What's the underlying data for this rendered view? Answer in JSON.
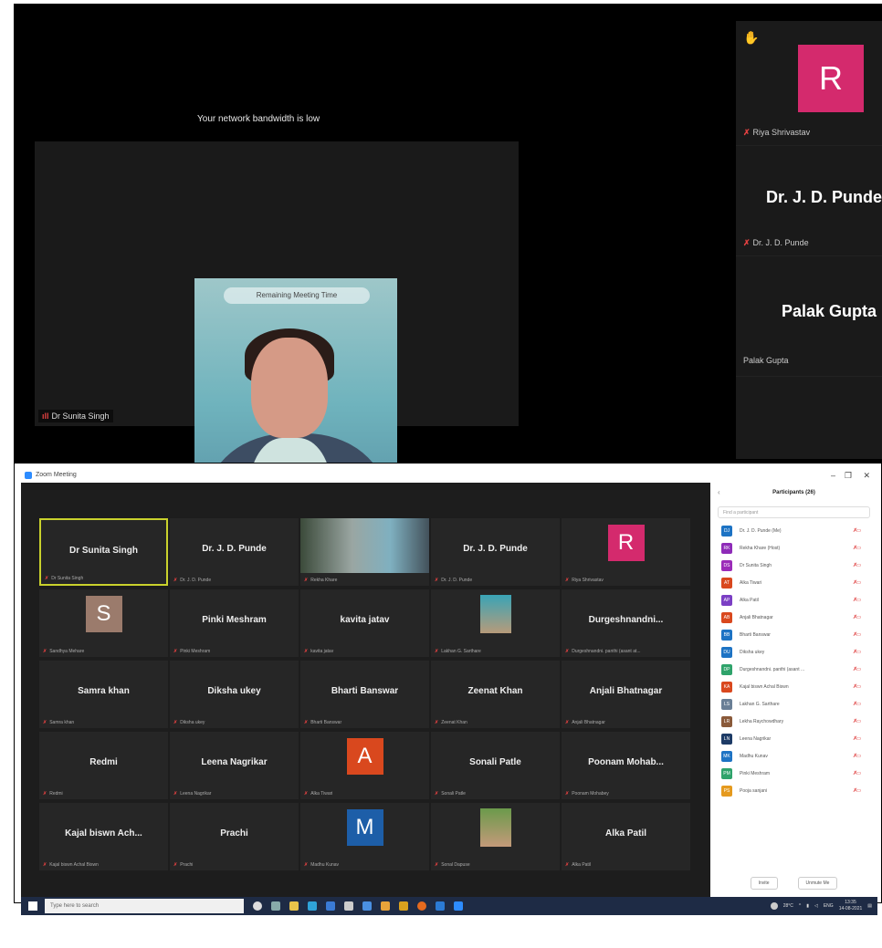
{
  "top_panel": {
    "bandwidth_warning": "Your network bandwidth is low",
    "video_banner": "Remaining Meeting Time",
    "main_speaker_name": "Dr Sunita Singh",
    "side_tiles": [
      {
        "avatar_letter": "R",
        "label": "Riya Shrivastav",
        "big_name": "",
        "avatar_color": "#d42a6d"
      },
      {
        "avatar_letter": "",
        "label": "Dr. J. D. Punde",
        "big_name": "Dr. J. D. Punde"
      },
      {
        "avatar_letter": "",
        "label": "Palak Gupta",
        "big_name": "Palak Gupta"
      }
    ]
  },
  "zoom_window": {
    "title": "Zoom Meeting",
    "gallery": [
      {
        "name": "Dr Sunita Singh",
        "label": "Dr Sunita Singh",
        "kind": "name",
        "active": true
      },
      {
        "name": "Dr. J. D. Punde",
        "label": "Dr. J. D. Punde",
        "kind": "name"
      },
      {
        "name": "",
        "label": "Rekha Khare",
        "kind": "video"
      },
      {
        "name": "Dr. J. D. Punde",
        "label": "Dr. J. D. Punde",
        "kind": "name"
      },
      {
        "name": "",
        "label": "Riya Shrivastav",
        "kind": "avatar",
        "letter": "R",
        "color": "#d42a6d"
      },
      {
        "name": "",
        "label": "Sandhya Mehare",
        "kind": "avatar",
        "letter": "S",
        "color": "#9b7b6c"
      },
      {
        "name": "Pinki Meshram",
        "label": "Pinki Meshram",
        "kind": "name"
      },
      {
        "name": "kavita jatav",
        "label": "kavita jatav",
        "kind": "name"
      },
      {
        "name": "",
        "label": "Lakhan G. Sarthare",
        "kind": "photo"
      },
      {
        "name": "Durgeshnandni...",
        "label": "Durgeshnandni. panthi (asant at...",
        "kind": "name"
      },
      {
        "name": "Samra khan",
        "label": "Samra khan",
        "kind": "name"
      },
      {
        "name": "Diksha ukey",
        "label": "Diksha ukey",
        "kind": "name"
      },
      {
        "name": "Bharti Banswar",
        "label": "Bharti Banswar",
        "kind": "name"
      },
      {
        "name": "Zeenat Khan",
        "label": "Zeenat Khan",
        "kind": "name"
      },
      {
        "name": "Anjali Bhatnagar",
        "label": "Anjali Bhatnagar",
        "kind": "name"
      },
      {
        "name": "Redmi",
        "label": "Redmi",
        "kind": "name"
      },
      {
        "name": "Leena Nagrikar",
        "label": "Leena Nagrikar",
        "kind": "name"
      },
      {
        "name": "",
        "label": "Alka Tiwari",
        "kind": "avatar",
        "letter": "A",
        "color": "#d9481e"
      },
      {
        "name": "Sonali Patle",
        "label": "Sonali Patle",
        "kind": "name"
      },
      {
        "name": "Poonam Mohab...",
        "label": "Poonam Mohabey",
        "kind": "name"
      },
      {
        "name": "Kajal biswn Ach...",
        "label": "Kajal biswn Achal Biswn",
        "kind": "name"
      },
      {
        "name": "Prachi",
        "label": "Prachi",
        "kind": "name"
      },
      {
        "name": "",
        "label": "Madhu Kunav",
        "kind": "avatar",
        "letter": "M",
        "color": "#1d5ea8"
      },
      {
        "name": "",
        "label": "Sonal Dapuse",
        "kind": "photo2"
      },
      {
        "name": "Alka Patil",
        "label": "Alka Patil",
        "kind": "name"
      }
    ],
    "participants": {
      "title": "Participants (26)",
      "search_placeholder": "Find a participant",
      "items": [
        {
          "initials": "DJ",
          "name": "Dr. J. D. Punde (Me)",
          "color": "#1d73c4"
        },
        {
          "initials": "RK",
          "name": "Rekha Khare (Host)",
          "color": "#8e2bb8"
        },
        {
          "initials": "DS",
          "name": "Dr Sunita Singh",
          "color": "#9b2bb8"
        },
        {
          "initials": "AT",
          "name": "Alka Tiwari",
          "color": "#d9481e"
        },
        {
          "initials": "AP",
          "name": "Alka Patil",
          "color": "#7b3fc4"
        },
        {
          "initials": "AB",
          "name": "Anjali Bhatnagar",
          "color": "#d9481e"
        },
        {
          "initials": "BB",
          "name": "Bharti Banswar",
          "color": "#1d73c4"
        },
        {
          "initials": "DU",
          "name": "Diksha ukey",
          "color": "#1d73c4"
        },
        {
          "initials": "DP",
          "name": "Durgeshnandni. panthi (asant ...",
          "color": "#2fa36b"
        },
        {
          "initials": "KA",
          "name": "Kajal biswn Achal Biswn",
          "color": "#d9481e"
        },
        {
          "initials": "LS",
          "name": "Lakhan G. Sarthare",
          "color": "#6a7f96"
        },
        {
          "initials": "LR",
          "name": "Lekha Raychowdhary",
          "color": "#8a5a3a"
        },
        {
          "initials": "LN",
          "name": "Leena Nagrikar",
          "color": "#1d3b66"
        },
        {
          "initials": "MK",
          "name": "Madhu Kunav",
          "color": "#1d73c4"
        },
        {
          "initials": "PM",
          "name": "Pinki Meshram",
          "color": "#2fa36b"
        },
        {
          "initials": "PS",
          "name": "Pooja sanjani",
          "color": "#e59a1e"
        }
      ],
      "invite_label": "Invite",
      "unmute_label": "Unmute Me"
    },
    "taskbar": {
      "search_placeholder": "Type here to search",
      "weather": "28°C",
      "lang": "ENG",
      "time": "13:35",
      "date": "14-08-2021"
    }
  }
}
